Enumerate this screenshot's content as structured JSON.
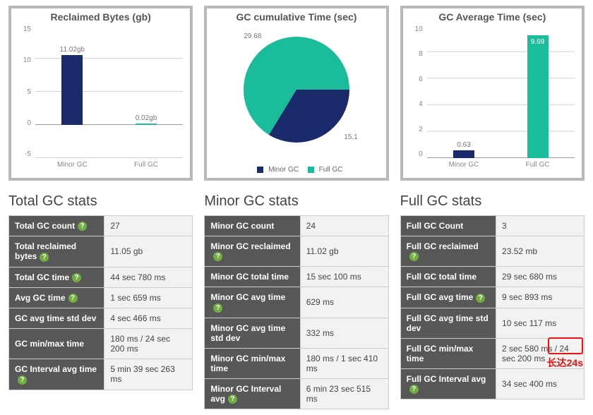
{
  "charts": {
    "reclaimed": {
      "title": "Reclaimed Bytes (gb)",
      "cat0": "Minor GC",
      "cat1": "Full GC",
      "lbl0": "11.02gb",
      "lbl1": "0.02gb",
      "t0": "15",
      "t1": "10",
      "t2": "5",
      "t3": "0",
      "t4": "-5"
    },
    "cumulative": {
      "title": "GC cumulative Time (sec)",
      "lbl_major": "29.68",
      "lbl_minor": "15.1",
      "legend_minor": "Minor GC",
      "legend_full": "Full GC"
    },
    "avg": {
      "title": "GC Average Time (sec)",
      "cat0": "Minor GC",
      "cat1": "Full GC",
      "lbl0": "0.63",
      "lbl1": "9.69",
      "t0": "10",
      "t1": "8",
      "t2": "6",
      "t3": "4",
      "t4": "2",
      "t5": "0"
    }
  },
  "total": {
    "title": "Total GC stats",
    "k0": "Total GC count",
    "v0": "27",
    "k1": "Total reclaimed bytes",
    "v1": "11.05 gb",
    "k2": "Total GC time",
    "v2": "44 sec 780 ms",
    "k3": "Avg GC time",
    "v3": "1 sec 659 ms",
    "k4": "GC avg time std dev",
    "v4": "4 sec 466 ms",
    "k5": "GC min/max time",
    "v5": "180 ms / 24 sec 200 ms",
    "k6": "GC Interval avg time",
    "v6": "5 min 39 sec 263 ms"
  },
  "minor": {
    "title": "Minor GC stats",
    "k0": "Minor GC count",
    "v0": "24",
    "k1": "Minor GC reclaimed",
    "v1": "11.02 gb",
    "k2": "Minor GC total time",
    "v2": "15 sec 100 ms",
    "k3": "Minor GC avg time",
    "v3": "629 ms",
    "k4": "Minor GC avg time std dev",
    "v4": "332 ms",
    "k5": "Minor GC min/max time",
    "v5": "180 ms / 1 sec 410 ms",
    "k6": "Minor GC Interval avg",
    "v6": "6 min 23 sec 515 ms"
  },
  "full": {
    "title": "Full GC stats",
    "k0": "Full GC Count",
    "v0": "3",
    "k1": "Full GC reclaimed",
    "v1": "23.52 mb",
    "k2": "Full GC total time",
    "v2": "29 sec 680 ms",
    "k3": "Full GC avg time",
    "v3": "9 sec 893 ms",
    "k4": "Full GC avg time std dev",
    "v4": "10 sec 117 ms",
    "k5": "Full GC min/max time",
    "v5": "2 sec 580 ms / 24 sec 200 ms",
    "k6": "Full GC Interval avg",
    "v6": "34 sec 400 ms"
  },
  "annotation": {
    "text": "长达24s"
  },
  "help_glyph": "?",
  "chart_data": [
    {
      "type": "bar",
      "title": "Reclaimed Bytes (gb)",
      "ylabel": "gb",
      "categories": [
        "Minor GC",
        "Full GC"
      ],
      "values": [
        11.02,
        0.02
      ],
      "ylim": [
        -5,
        15
      ]
    },
    {
      "type": "pie",
      "title": "GC cumulative Time (sec)",
      "series": [
        {
          "name": "Minor GC",
          "value": 15.1
        },
        {
          "name": "Full GC",
          "value": 29.68
        }
      ]
    },
    {
      "type": "bar",
      "title": "GC Average Time (sec)",
      "ylabel": "sec",
      "categories": [
        "Minor GC",
        "Full GC"
      ],
      "values": [
        0.63,
        9.69
      ],
      "ylim": [
        0,
        10
      ]
    }
  ]
}
